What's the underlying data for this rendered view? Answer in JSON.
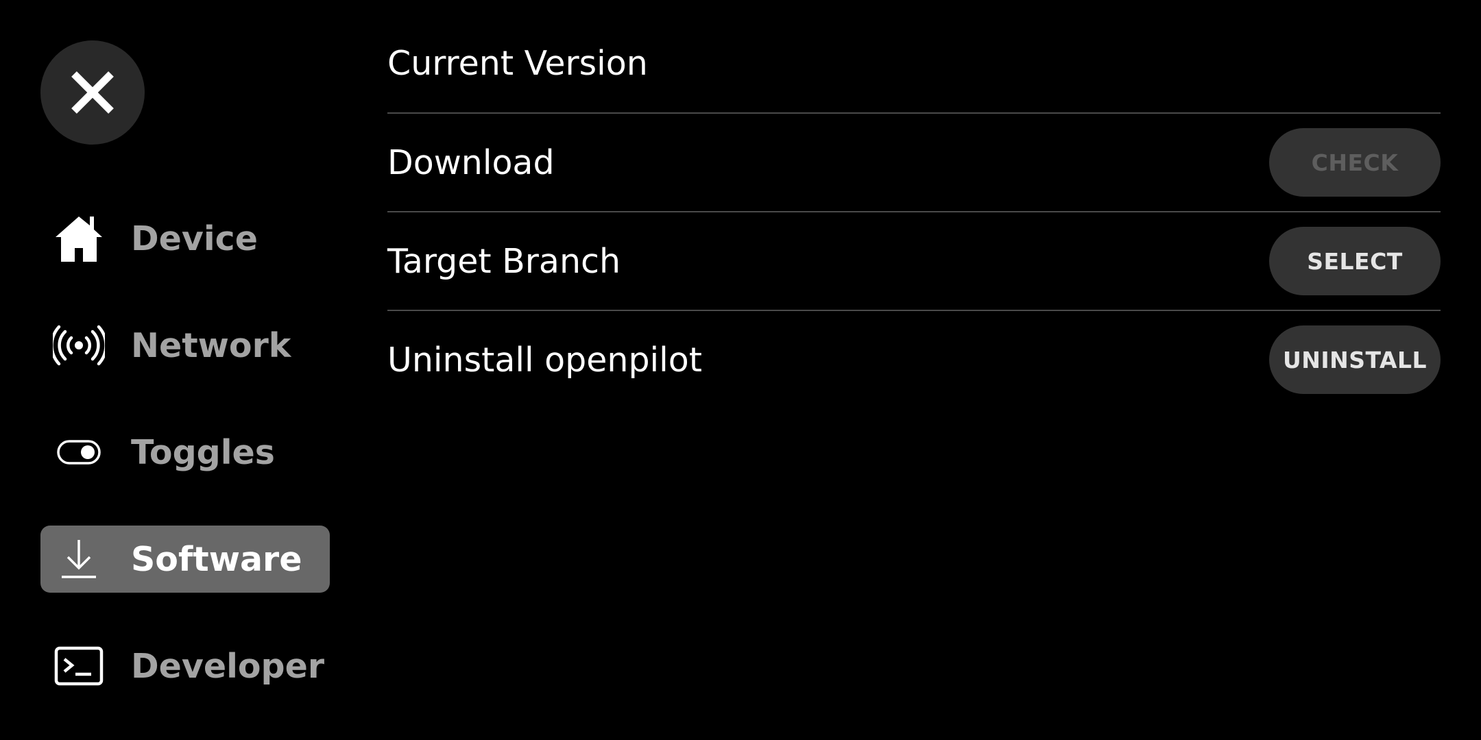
{
  "sidebar": {
    "close_icon": "close-icon",
    "items": [
      {
        "label": "Device",
        "icon": "home-icon",
        "active": false
      },
      {
        "label": "Network",
        "icon": "wifi-broadcast-icon",
        "active": false
      },
      {
        "label": "Toggles",
        "icon": "toggle-icon",
        "active": false
      },
      {
        "label": "Software",
        "icon": "download-icon",
        "active": true
      },
      {
        "label": "Developer",
        "icon": "terminal-icon",
        "active": false
      }
    ]
  },
  "software": {
    "current_version": {
      "label": "Current Version"
    },
    "download": {
      "label": "Download",
      "button": "CHECK",
      "button_enabled": false
    },
    "target_branch": {
      "label": "Target Branch",
      "button": "SELECT"
    },
    "uninstall": {
      "label": "Uninstall openpilot",
      "button": "UNINSTALL"
    }
  },
  "colors": {
    "background": "#000000",
    "active_nav": "#686868",
    "button_bg": "#333333",
    "close_bg": "#292929",
    "divider": "#4a4a4a"
  }
}
